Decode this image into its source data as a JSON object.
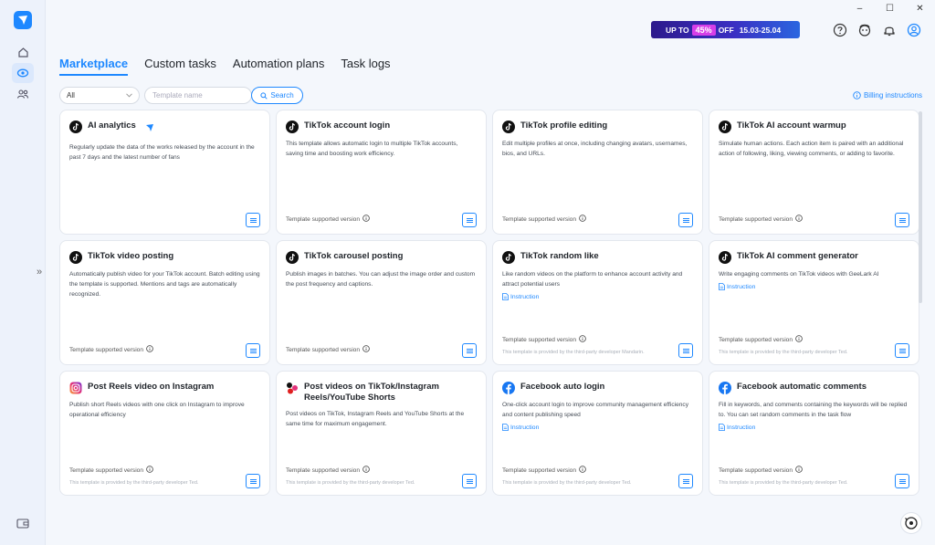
{
  "window": {
    "minimize": "–",
    "maximize": "☐",
    "close": "✕"
  },
  "promo": {
    "prefix": "UP TO",
    "percent": "45%",
    "suffix": "OFF",
    "dates": "15.03-25.04"
  },
  "tabs": [
    {
      "label": "Marketplace",
      "active": true
    },
    {
      "label": "Custom tasks",
      "active": false
    },
    {
      "label": "Automation plans",
      "active": false
    },
    {
      "label": "Task logs",
      "active": false
    }
  ],
  "filter": {
    "selected": "All",
    "placeholder": "Template name",
    "search_label": "Search",
    "billing_label": "Billing instructions"
  },
  "cards": [
    {
      "icon": "ai",
      "title": "AI analytics",
      "desc": "Regularly update the data of the works released by the account in the past 7 days and the latest number of fans",
      "instruction": "",
      "footer": "",
      "provider": ""
    },
    {
      "icon": "tiktok",
      "title": "TikTok account login",
      "desc": "This template allows automatic login to multiple TikTok accounts, saving time and boosting work efficiency.",
      "instruction": "",
      "footer": "Template supported version",
      "provider": ""
    },
    {
      "icon": "tiktok",
      "title": "TikTok profile editing",
      "desc": "Edit multiple profiles at once, including changing avatars, usernames, bios, and URLs.",
      "instruction": "",
      "footer": "Template supported version",
      "provider": ""
    },
    {
      "icon": "tiktok",
      "title": "TikTok AI account warmup",
      "desc": "Simulate human actions. Each action item is paired with an additional action of following, liking, viewing comments, or adding to favorite.",
      "instruction": "",
      "footer": "Template supported version",
      "provider": ""
    },
    {
      "icon": "tiktok",
      "title": "TikTok video posting",
      "desc": "Automatically publish video for your TikTok account. Batch editing using the template is supported. Mentions and tags are automatically recognized.",
      "instruction": "",
      "footer": "Template supported version",
      "provider": ""
    },
    {
      "icon": "tiktok",
      "title": "TikTok carousel posting",
      "desc": "Publish images in batches. You can adjust the image order and custom the post frequency and captions.",
      "instruction": "",
      "footer": "Template supported version",
      "provider": ""
    },
    {
      "icon": "tiktok",
      "title": "TikTok random like",
      "desc": "Like random videos on the platform to enhance account activity and attract potential users",
      "instruction": "Instruction",
      "footer": "Template supported version",
      "provider": "This template is provided by the third-party developer Mandarin."
    },
    {
      "icon": "tiktok",
      "title": "TikTok AI comment generator",
      "desc": "Write engaging comments on TikTok videos with GeeLark AI",
      "instruction": "Instruction",
      "footer": "Template supported version",
      "provider": "This template is provided by the third-party developer Ted."
    },
    {
      "icon": "instagram",
      "title": "Post Reels video on Instagram",
      "desc": "Publish short Reels videos with one click on Instagram to improve operational efficiency",
      "instruction": "",
      "footer": "Template supported version",
      "provider": "This template is provided by the third-party developer Ted."
    },
    {
      "icon": "multi",
      "title": "Post videos on TikTok/Instagram Reels/YouTube Shorts",
      "desc": "Post videos on TikTok, Instagram Reels and YouTube Shorts at the same time for maximum engagement.",
      "instruction": "",
      "footer": "Template supported version",
      "provider": "This template is provided by the third-party developer Ted."
    },
    {
      "icon": "facebook",
      "title": "Facebook auto login",
      "desc": "One-click account login to improve community management efficiency and content publishing speed",
      "instruction": "Instruction",
      "footer": "Template supported version",
      "provider": "This template is provided by the third-party developer Ted."
    },
    {
      "icon": "facebook",
      "title": "Facebook automatic comments",
      "desc": "Fill in keywords, and comments containing the keywords will be replied to. You can set random comments in the task flow",
      "instruction": "Instruction",
      "footer": "Template supported version",
      "provider": "This template is provided by the third-party developer Ted."
    }
  ],
  "colors": {
    "accent": "#1e88ff",
    "background": "#f4f7fc"
  }
}
